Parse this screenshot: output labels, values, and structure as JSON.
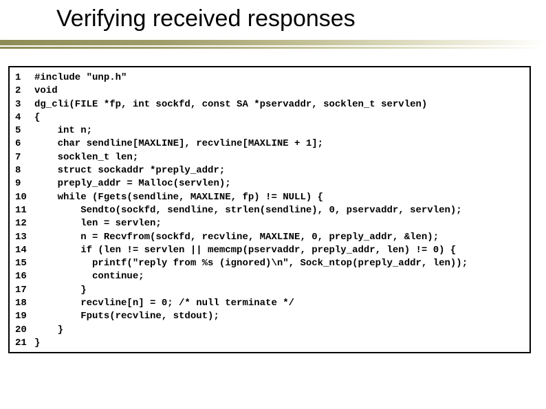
{
  "title": "Verifying received responses",
  "code": {
    "lines": [
      {
        "n": "1",
        "t": "#include \"unp.h\""
      },
      {
        "n": "2",
        "t": "void"
      },
      {
        "n": "3",
        "t": "dg_cli(FILE *fp, int sockfd, const SA *pservaddr, socklen_t servlen)"
      },
      {
        "n": "4",
        "t": "{"
      },
      {
        "n": "5",
        "t": "    int n;"
      },
      {
        "n": "6",
        "t": "    char sendline[MAXLINE], recvline[MAXLINE + 1];"
      },
      {
        "n": "7",
        "t": "    socklen_t len;"
      },
      {
        "n": "8",
        "t": "    struct sockaddr *preply_addr;"
      },
      {
        "n": "9",
        "t": "    preply_addr = Malloc(servlen);"
      },
      {
        "n": "10",
        "t": "    while (Fgets(sendline, MAXLINE, fp) != NULL) {"
      },
      {
        "n": "11",
        "t": "        Sendto(sockfd, sendline, strlen(sendline), 0, pservaddr, servlen);"
      },
      {
        "n": "12",
        "t": "        len = servlen;"
      },
      {
        "n": "13",
        "t": "        n = Recvfrom(sockfd, recvline, MAXLINE, 0, preply_addr, &len);"
      },
      {
        "n": "14",
        "t": "        if (len != servlen || memcmp(pservaddr, preply_addr, len) != 0) {"
      },
      {
        "n": "15",
        "t": "          printf(\"reply from %s (ignored)\\n\", Sock_ntop(preply_addr, len));"
      },
      {
        "n": "16",
        "t": "          continue;"
      },
      {
        "n": "17",
        "t": "        }"
      },
      {
        "n": "18",
        "t": "        recvline[n] = 0; /* null terminate */"
      },
      {
        "n": "19",
        "t": "        Fputs(recvline, stdout);"
      },
      {
        "n": "20",
        "t": "    }"
      },
      {
        "n": "21",
        "t": "}"
      }
    ]
  }
}
